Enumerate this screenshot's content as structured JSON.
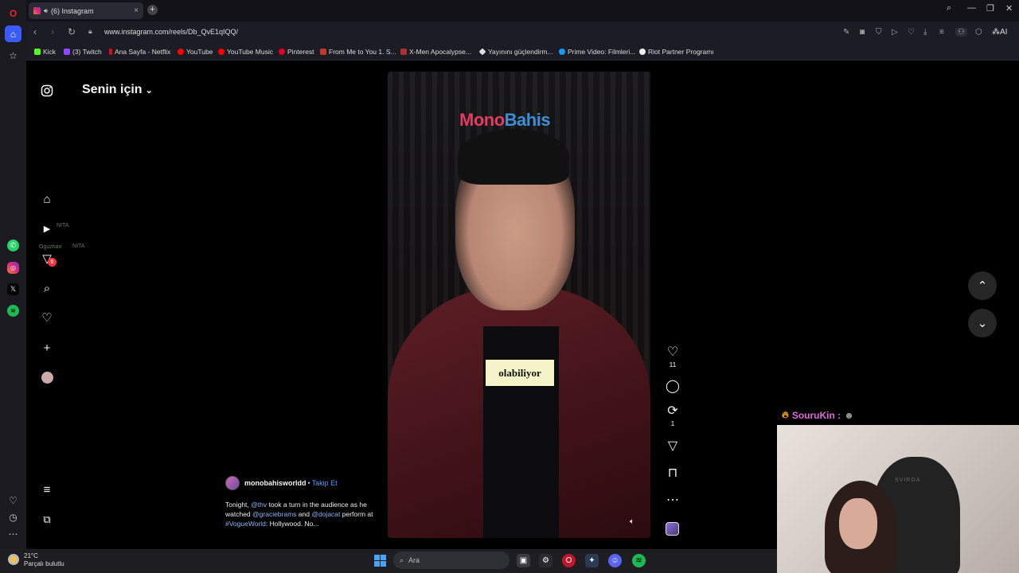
{
  "browser": {
    "tab_title": "(6) Instagram",
    "url": "www.instagram.com/reels/Db_QvE1qIQQ/",
    "bookmarks": [
      {
        "label": "Kick",
        "color": "#53fc18"
      },
      {
        "label": "(3) Twitch",
        "color": "#9146ff"
      },
      {
        "label": "Ana Sayfa - Netflix",
        "color": "#e50914"
      },
      {
        "label": "YouTube",
        "color": "#ff0000"
      },
      {
        "label": "YouTube Music",
        "color": "#ff0000"
      },
      {
        "label": "Pinterest",
        "color": "#e60023"
      },
      {
        "label": "From Me to You 1. S...",
        "color": "#c0392b"
      },
      {
        "label": "X-Men Apocalypse...",
        "color": "#b03030"
      },
      {
        "label": "Yayınını güçlendirm...",
        "color": "#dddddd"
      },
      {
        "label": "Prime Video: Filmleri...",
        "color": "#1a98ff"
      },
      {
        "label": "Riot Partner Programı",
        "color": "#eeeeee"
      }
    ],
    "ai_label": "AI"
  },
  "instagram": {
    "feed_title": "Senin için",
    "notification_count": "6",
    "reel": {
      "brand_part1": "Mono",
      "brand_part2": "Bahis",
      "subtitle": "olabiliyor",
      "like_count": "11",
      "repost_count": "1",
      "username": "monobahisworldd",
      "separator": " • ",
      "follow_label": "Takip Et",
      "caption_parts": [
        {
          "text": "Tonight, ",
          "mention": false
        },
        {
          "text": "@thv",
          "mention": true
        },
        {
          "text": " took a turn in the audience as he watched ",
          "mention": false
        },
        {
          "text": "@graciebrams",
          "mention": true
        },
        {
          "text": " and ",
          "mention": false
        },
        {
          "text": "@dojacat",
          "mention": true
        },
        {
          "text": " perform at ",
          "mention": false
        },
        {
          "text": "#VogueWorld",
          "mention": true
        },
        {
          "text": ": Hollywood. No...",
          "mention": false
        }
      ]
    }
  },
  "overlay": {
    "ghost_chat": [
      "NITA",
      "Oguzhan",
      "NITA"
    ],
    "chat_username": "SouruKin :",
    "chair_brand": "SVIRGA"
  },
  "taskbar": {
    "temperature": "21°C",
    "weather_text": "Parçalı bulutlu",
    "search_placeholder": "Ara"
  }
}
